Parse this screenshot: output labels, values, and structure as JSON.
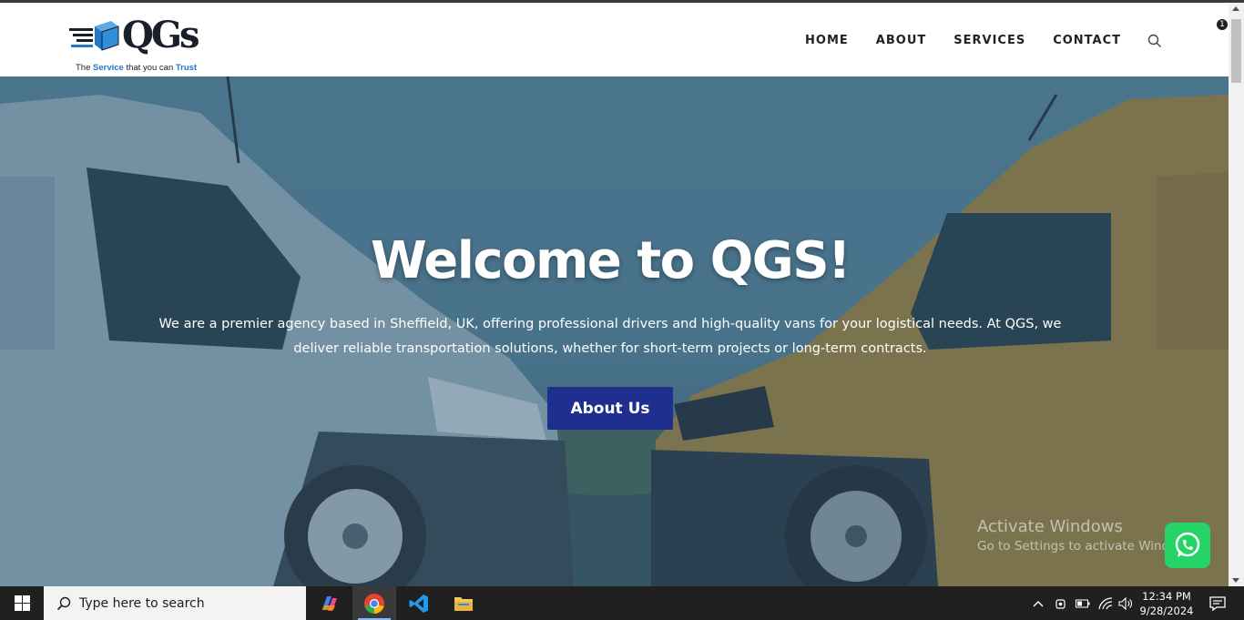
{
  "brand": {
    "logo_text": "QGs",
    "tagline_prefix": "The",
    "tagline_highlight": "Service",
    "tagline_middle": "that you can",
    "tagline_end": "Trust",
    "colors": {
      "dark": "#1b1f2c",
      "accent": "#1f78c8"
    }
  },
  "nav": {
    "items": [
      {
        "label": "HOME"
      },
      {
        "label": "ABOUT"
      },
      {
        "label": "SERVICES"
      },
      {
        "label": "CONTACT"
      }
    ],
    "search_icon": "search-icon"
  },
  "hero": {
    "title": "Welcome to QGS!",
    "text": "We are a premier agency based in Sheffield, UK, offering professional drivers and high-quality vans for your logistical needs. At QGS, we deliver reliable transportation solutions, whether for short-term projects or long-term contracts.",
    "button_label": "About Us",
    "button_color": "#1f2f8f"
  },
  "watermark": {
    "line1": "Activate Windows",
    "line2": "Go to Settings to activate Windows."
  },
  "whatsapp": {
    "icon": "whatsapp-icon",
    "color": "#25d366"
  },
  "taskbar": {
    "search_placeholder": "Type here to search",
    "apps": [
      "copilot-icon",
      "chrome-icon",
      "vscode-icon",
      "file-explorer-icon"
    ],
    "clock_time": "12:34 PM",
    "clock_date": "9/28/2024",
    "notification_count": "1"
  }
}
